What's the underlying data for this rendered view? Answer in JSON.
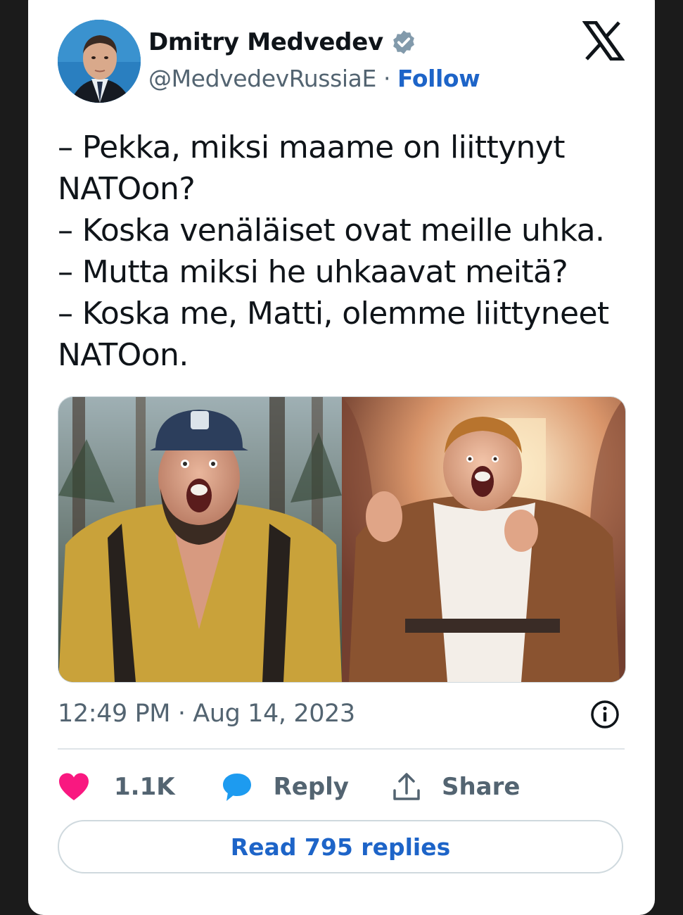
{
  "author": {
    "name": "Dmitry Medvedev",
    "handle": "@MedvedevRussiaE",
    "separator": "·",
    "follow_label": "Follow"
  },
  "tweet": {
    "lines": [
      "– Pekka, miksi maame  on liittynyt",
      "NATOon?",
      "– Koska venäläiset ovat meille uhka.",
      "– Mutta miksi he uhkaavat meitä?",
      "– Koska me, Matti, olemme liittyneet",
      "NATOon."
    ],
    "timestamp": "12:49 PM · Aug 14, 2023"
  },
  "actions": {
    "like_count": "1.1K",
    "reply_label": "Reply",
    "share_label": "Share"
  },
  "read_replies_label": "Read 795 replies",
  "icons": {
    "verified": "verified-badge-icon",
    "x_logo": "x-logo-icon",
    "info": "info-icon",
    "like": "heart-icon",
    "reply": "speech-bubble-icon",
    "share": "share-upload-icon"
  },
  "colors": {
    "follow": "#1d64c8",
    "like": "#f91880",
    "reply": "#1d9bf0",
    "secondary_text": "#536471"
  }
}
